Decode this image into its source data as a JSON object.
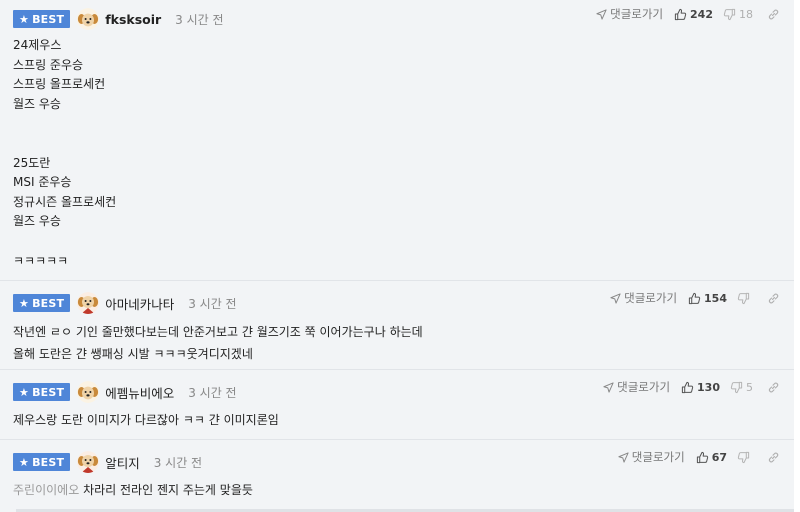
{
  "comments": [
    {
      "badge": "BEST",
      "nickname": "fksksoir",
      "time": "3 시간 전",
      "reply_label": "댓글로가기",
      "likes": "242",
      "dislikes": "18",
      "lines": [
        "24제우스",
        "스프링 준우승",
        "스프링 올프로세컨",
        "월즈 우승",
        "",
        "",
        "25도란",
        "MSI 준우승",
        "정규시즌 올프로세컨",
        "월즈 우승",
        "",
        "ㅋㅋㅋㅋㅋ"
      ]
    },
    {
      "badge": "BEST",
      "nickname": "아마네카나타",
      "time": "3 시간 전",
      "reply_label": "댓글로가기",
      "likes": "154",
      "dislikes": "",
      "lines": [
        "작년엔 ㄹㅇ 기인 줄만했다보는데 안준거보고 갼 월즈기조 쭉 이어가는구나 하는데",
        "올해 도란은 갼 쌩패싱 시발 ㅋㅋㅋ웃겨디지겠네"
      ]
    },
    {
      "badge": "BEST",
      "nickname": "에펨뉴비에오",
      "time": "3 시간 전",
      "reply_label": "댓글로가기",
      "likes": "130",
      "dislikes": "5",
      "text": "제우스랑 도란 이미지가 다르잖아 ㅋㅋ 갼 이미지론임"
    },
    {
      "badge": "BEST",
      "nickname": "알티지",
      "time": "3 시간 전",
      "reply_label": "댓글로가기",
      "likes": "67",
      "dislikes": "",
      "mention": "주린이이에오",
      "text": "차라리 전라인 젠지 주는게 맞을듯"
    }
  ],
  "icons": {
    "best": "star-icon",
    "reply": "arrow-icon",
    "like": "thumbs-up-icon",
    "dislike": "thumbs-down-icon",
    "link": "link-icon"
  },
  "colors": {
    "best_badge": "#4f86d8",
    "background": "#f2f4f6"
  }
}
